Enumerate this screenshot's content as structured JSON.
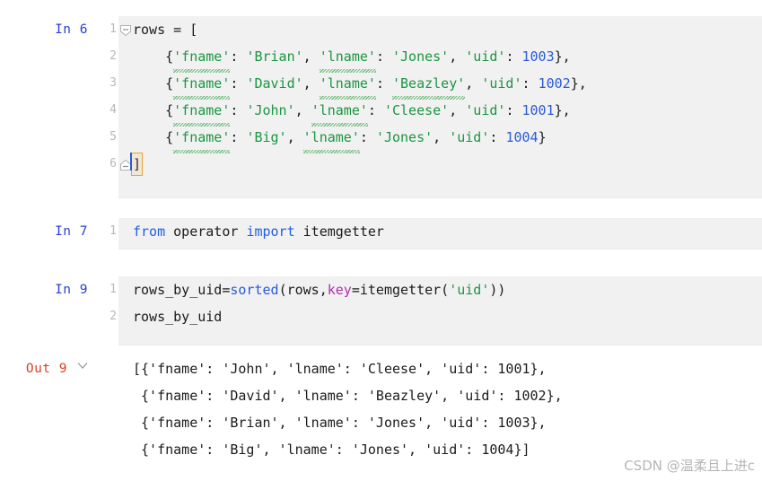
{
  "watermark": "CSDN @温柔且上进c",
  "colors": {
    "cell_background": "#f1f1f1",
    "page_background": "#ffffff",
    "in_prompt": "#2a3fd4",
    "out_prompt": "#d94224",
    "string": "#1a9641",
    "number": "#2a5bd7",
    "keyword": "#1f5fe0",
    "kwarg": "#b02fb0",
    "linenumber": "#b8b8b8",
    "squiggle": "#5bb56b"
  },
  "cells": [
    {
      "prompt": "In 6",
      "type": "code",
      "linenos": [
        "1",
        "2",
        "3",
        "4",
        "5",
        "6"
      ],
      "fold_top": "fold-open-icon",
      "fold_bottom": "fold-end-icon",
      "lines": [
        {
          "n": "1",
          "text": "rows = ["
        },
        {
          "n": "2",
          "text": "    {'fname': 'Brian', 'lname': 'Jones', 'uid': 1003},"
        },
        {
          "n": "3",
          "text": "    {'fname': 'David', 'lname': 'Beazley', 'uid': 1002},"
        },
        {
          "n": "4",
          "text": "    {'fname': 'John', 'lname': 'Cleese', 'uid': 1001},"
        },
        {
          "n": "5",
          "text": "    {'fname': 'Big', 'lname': 'Jones', 'uid': 1004}"
        },
        {
          "n": "6",
          "text": "]"
        }
      ]
    },
    {
      "prompt": "In 7",
      "type": "code",
      "linenos": [
        "1"
      ],
      "lines": [
        {
          "n": "1",
          "text": "from operator import itemgetter"
        }
      ]
    },
    {
      "prompt": "In 9",
      "type": "code",
      "linenos": [
        "1",
        "2"
      ],
      "lines": [
        {
          "n": "1",
          "text": "rows_by_uid=sorted(rows,key=itemgetter('uid'))"
        },
        {
          "n": "2",
          "text": "rows_by_uid"
        }
      ]
    },
    {
      "prompt": "Out 9",
      "type": "output",
      "chevron": "chevron-down-icon",
      "lines": [
        "[{'fname': 'John', 'lname': 'Cleese', 'uid': 1001},",
        " {'fname': 'David', 'lname': 'Beazley', 'uid': 1002},",
        " {'fname': 'Brian', 'lname': 'Jones', 'uid': 1003},",
        " {'fname': 'Big', 'lname': 'Jones', 'uid': 1004}]"
      ]
    }
  ],
  "tokens": {
    "c1l1": {
      "code": "rows = ["
    },
    "c1l2_a": "{",
    "c1l2_fname": "'fname'",
    "c1l2_b": ": ",
    "c1l2_v1": "'Brian'",
    "c1l2_c": ", ",
    "c1l2_lname": "'lname'",
    "c1l2_d": ": ",
    "c1l2_v2": "'Jones'",
    "c1l2_e": ", ",
    "c1l2_uid": "'uid'",
    "c1l2_f": ": ",
    "c1l2_num": "1003",
    "c1l2_g": "},",
    "c1l3_v1": "'David'",
    "c1l3_v2": "'Beazley'",
    "c1l3_num": "1002",
    "c1l3_g": "},",
    "c1l4_v1": "'John'",
    "c1l4_v2": "'Cleese'",
    "c1l4_num": "1001",
    "c1l4_g": "},",
    "c1l5_v1": "'Big'",
    "c1l5_v2": "'Jones'",
    "c1l5_num": "1004",
    "c1l5_g": "}",
    "c1l6": "]",
    "fname_key": "'fname'",
    "lname_key": "'lname'",
    "uid_key": "'uid'",
    "colon_sp": ": ",
    "comma_sp": ", ",
    "open_brace": "{",
    "indent": "    ",
    "c2_from": "from",
    "c2_operator": " operator ",
    "c2_import": "import",
    "c2_itemgetter": " itemgetter",
    "c3_lhs": "rows_by_uid=",
    "c3_sorted": "sorted",
    "c3_open": "(rows,",
    "c3_key": "key",
    "c3_eq": "=itemgetter(",
    "c3_uid": "'uid'",
    "c3_close": "))",
    "c3_l2": "rows_by_uid"
  }
}
